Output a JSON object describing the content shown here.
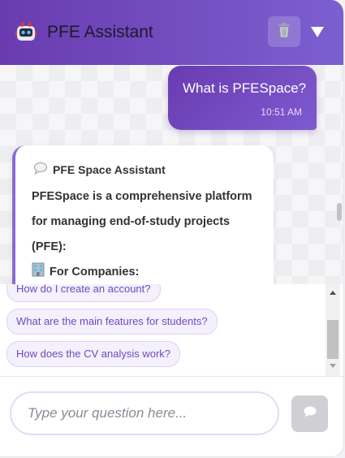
{
  "header": {
    "title": "PFE Assistant",
    "bot_icon": "robot-icon",
    "trash_icon": "trash-icon",
    "collapse_icon": "triangle-down-icon",
    "gradient_start": "#6a3bb0",
    "gradient_end": "#7b5fd0"
  },
  "messages": {
    "user": {
      "text": "What is PFESpace?",
      "time": "10:51 AM"
    },
    "bot": {
      "sender": "PFE Space Assistant",
      "sender_icon": "speech-bubble-icon",
      "intro": "PFESpace is a comprehensive platform for managing end-of-study projects (PFE):",
      "section_icon": "building-icon",
      "section_title": "For Companies:"
    }
  },
  "suggestions": [
    "How do I create an account?",
    "What are the main features for students?",
    "How does the CV analysis work?"
  ],
  "input": {
    "placeholder": "Type your question here...",
    "value": "",
    "send_icon": "chat-bubble-icon"
  },
  "colors": {
    "accent": "#6a3bb0",
    "chip_text": "#6c4bbd",
    "chip_bg": "#f4f0fc"
  }
}
